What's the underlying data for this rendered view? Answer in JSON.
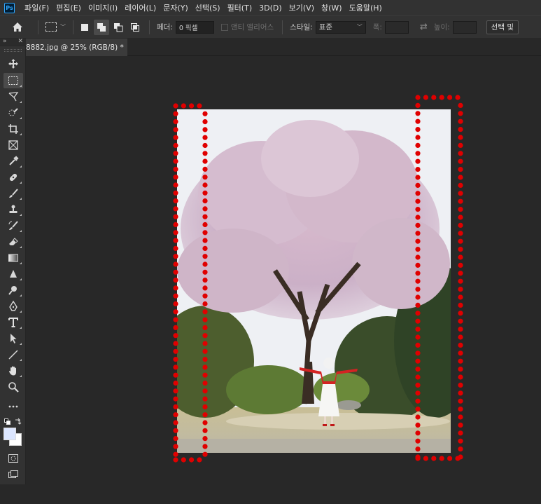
{
  "app": {
    "logo": "Ps"
  },
  "menu": [
    "파일(F)",
    "편집(E)",
    "이미지(I)",
    "레이어(L)",
    "문자(Y)",
    "선택(S)",
    "필터(T)",
    "3D(D)",
    "보기(V)",
    "창(W)",
    "도움말(H)"
  ],
  "options": {
    "feather_label": "페더:",
    "feather_value": "0 픽셀",
    "antialias_label": "앤티 앨리어스",
    "style_label": "스타일:",
    "style_value": "표준",
    "width_label": "폭:",
    "height_label": "높이:",
    "select_mask_label": "선택 및"
  },
  "tool_panel": {
    "expand": "»",
    "close": "✕"
  },
  "document": {
    "tab_title": "8882.jpg @ 25% (RGB/8) *",
    "close": "×"
  },
  "colors": {
    "foreground": "#dce6ff",
    "background": "#ffffff",
    "annotation": "#e00000"
  },
  "tools": [
    "move-icon",
    "marquee-icon",
    "lasso-icon",
    "quick-select-icon",
    "crop-icon",
    "frame-icon",
    "eyedropper-icon",
    "healing-icon",
    "brush-icon",
    "stamp-icon",
    "history-brush-icon",
    "eraser-icon",
    "gradient-icon",
    "blur-icon",
    "dodge-icon",
    "pen-icon",
    "type-icon",
    "path-select-icon",
    "line-icon",
    "hand-icon",
    "zoom-icon",
    "more-icon"
  ]
}
